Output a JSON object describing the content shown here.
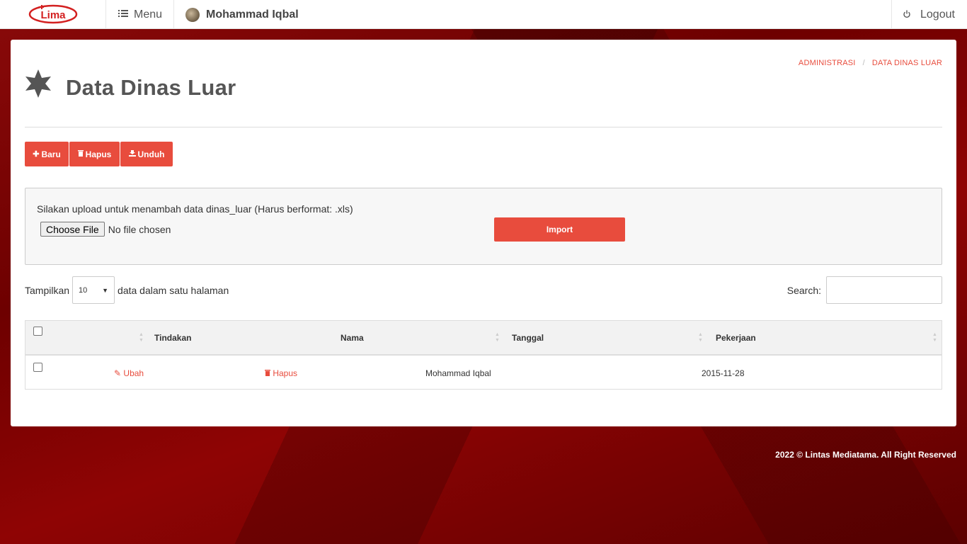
{
  "navbar": {
    "logo_text": "Lima",
    "menu_label": "Menu",
    "user_name": "Mohammad Iqbal",
    "logout_label": "Logout"
  },
  "page": {
    "title": "Data Dinas Luar",
    "breadcrumb": [
      "ADMINISTRASI",
      "DATA DINAS LUAR"
    ]
  },
  "toolbar": {
    "new_label": "Baru",
    "delete_label": "Hapus",
    "download_label": "Unduh"
  },
  "upload": {
    "instruction": "Silakan upload untuk menambah data dinas_luar (Harus berformat: .xls)",
    "choose_file_label": "Choose File",
    "no_file_text": "No file chosen",
    "import_label": "Import"
  },
  "table_controls": {
    "show_prefix": "Tampilkan",
    "page_size": "10",
    "show_suffix": "data dalam satu halaman",
    "search_label": "Search:"
  },
  "table": {
    "headers": [
      "Tindakan",
      "Nama",
      "Tanggal",
      "Pekerjaan"
    ],
    "rows": [
      {
        "edit_label": "Ubah",
        "delete_label": "Hapus",
        "nama": "Mohammad Iqbal",
        "tanggal": "2015-11-28",
        "pekerjaan": ""
      }
    ]
  },
  "footer": {
    "copyright": "2022 © Lintas Mediatama. All Right Reserved"
  },
  "colors": {
    "accent": "#e84c3d",
    "background": "#7a0000"
  }
}
